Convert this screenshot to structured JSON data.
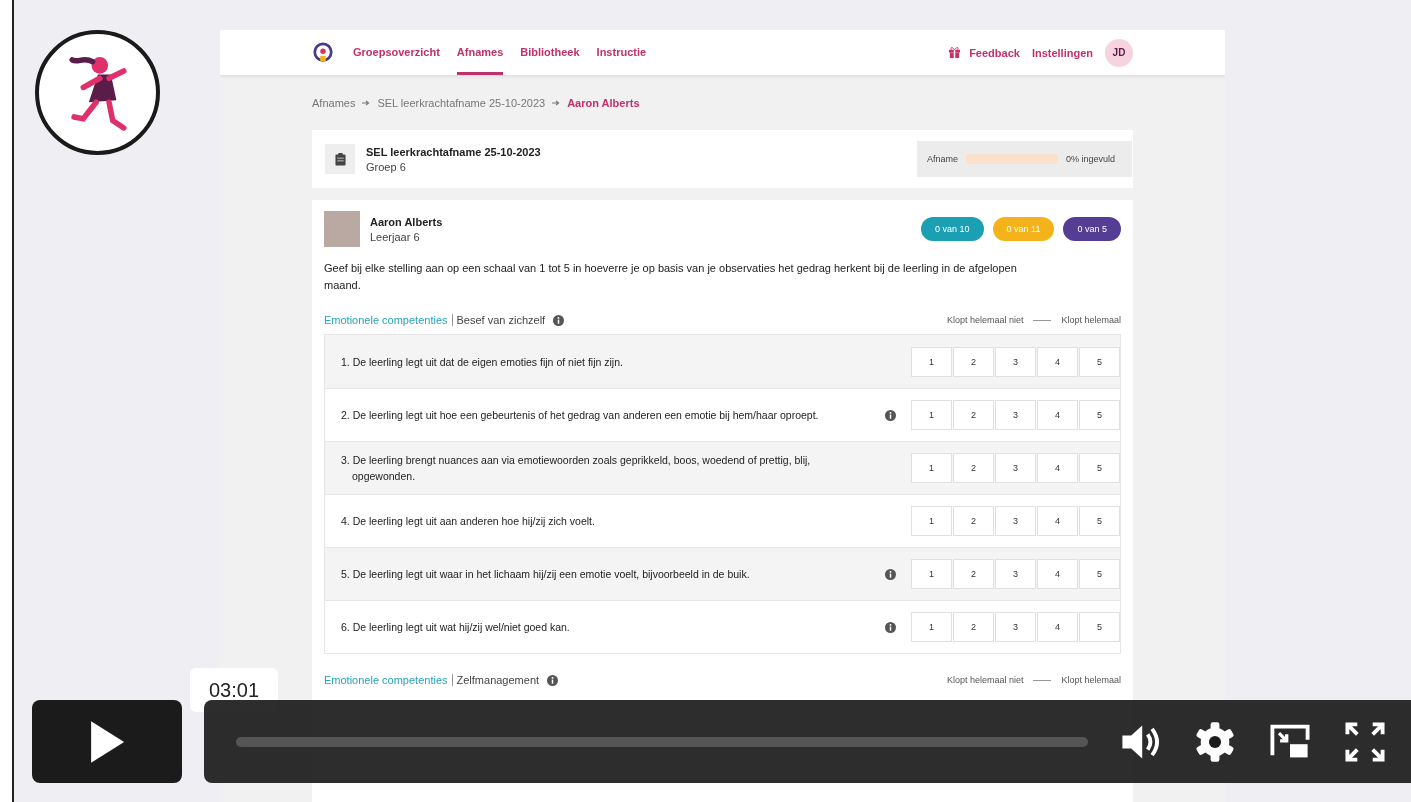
{
  "nav": {
    "items": [
      {
        "label": "Groepsoverzicht",
        "selected": false
      },
      {
        "label": "Afnames",
        "selected": true
      },
      {
        "label": "Bibliotheek",
        "selected": false
      },
      {
        "label": "Instructie",
        "selected": false
      }
    ],
    "links": [
      "Feedback",
      "Instellingen"
    ],
    "avatar": "JD"
  },
  "breadcrumb": [
    "Afnames",
    "SEL leerkrachtafname 25-10-2023",
    "Aaron Alberts"
  ],
  "assessment": {
    "title": "SEL leerkrachtafname 25-10-2023",
    "group": "Groep 6",
    "progress_label": "Afname",
    "level": 0,
    "reading": "0% ingevuld"
  },
  "student": {
    "name": "Aaron Alberts",
    "year": "Leerjaar 6",
    "badges": [
      {
        "label": "0 van 10",
        "color": "#1b9fb2"
      },
      {
        "label": "0 van 11",
        "color": "#f5b31b"
      },
      {
        "label": "0 van 5",
        "color": "#553d95"
      }
    ]
  },
  "instruction": "Geef bij elke stelling aan op een schaal van 1 tot 5 in hoeverre je op basis van je observaties het gedrag herkent bij de leerling in de afgelopen maand.",
  "sections": [
    {
      "category": "Emotionele competenties",
      "topic": "Besef van zichzelf",
      "scale_low": "Klopt helemaal niet",
      "scale_high": "Klopt helemaal",
      "statements": [
        {
          "text": "1. De leerling legt uit dat de eigen emoties fijn of niet fijn zijn.",
          "info": false,
          "options": [
            {
              "label": "1",
              "selected": false
            },
            {
              "label": "2",
              "selected": false
            },
            {
              "label": "3",
              "selected": false
            },
            {
              "label": "4",
              "selected": false
            },
            {
              "label": "5",
              "selected": false
            }
          ]
        },
        {
          "text": "2. De leerling legt uit hoe een gebeurtenis of het gedrag van anderen een emotie bij hem/haar oproept.",
          "info": true,
          "options": [
            {
              "label": "1",
              "selected": false
            },
            {
              "label": "2",
              "selected": false
            },
            {
              "label": "3",
              "selected": false
            },
            {
              "label": "4",
              "selected": false
            },
            {
              "label": "5",
              "selected": false
            }
          ]
        },
        {
          "text": "3. De leerling brengt nuances aan via emotiewoorden zoals geprikkeld, boos, woedend of prettig, blij, opgewonden.",
          "info": false,
          "options": [
            {
              "label": "1",
              "selected": false
            },
            {
              "label": "2",
              "selected": false
            },
            {
              "label": "3",
              "selected": false
            },
            {
              "label": "4",
              "selected": false
            },
            {
              "label": "5",
              "selected": false
            }
          ]
        },
        {
          "text": "4. De leerling legt uit aan anderen hoe hij/zij zich voelt.",
          "info": false,
          "options": [
            {
              "label": "1",
              "selected": false
            },
            {
              "label": "2",
              "selected": false
            },
            {
              "label": "3",
              "selected": false
            },
            {
              "label": "4",
              "selected": false
            },
            {
              "label": "5",
              "selected": false
            }
          ]
        },
        {
          "text": "5. De leerling legt uit waar in het lichaam hij/zij een emotie voelt, bijvoorbeeld in de buik.",
          "info": true,
          "options": [
            {
              "label": "1",
              "selected": false
            },
            {
              "label": "2",
              "selected": false
            },
            {
              "label": "3",
              "selected": false
            },
            {
              "label": "4",
              "selected": false
            },
            {
              "label": "5",
              "selected": false
            }
          ]
        },
        {
          "text": "6. De leerling legt uit wat hij/zij wel/niet goed kan.",
          "info": true,
          "options": [
            {
              "label": "1",
              "selected": false
            },
            {
              "label": "2",
              "selected": false
            },
            {
              "label": "3",
              "selected": false
            },
            {
              "label": "4",
              "selected": false
            },
            {
              "label": "5",
              "selected": false
            }
          ]
        }
      ]
    },
    {
      "category": "Emotionele competenties",
      "topic": "Zelfmanagement",
      "scale_low": "Klopt helemaal niet",
      "scale_high": "Klopt helemaal"
    }
  ],
  "player": {
    "time": "03:01"
  }
}
